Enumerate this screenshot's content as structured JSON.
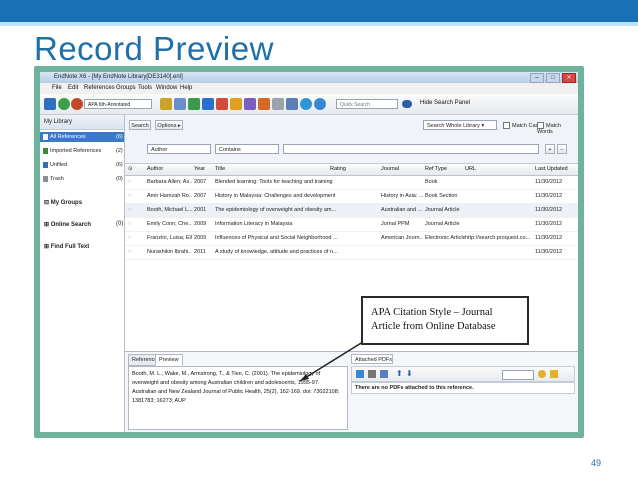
{
  "slide": {
    "title": "Record Preview",
    "page_number": "49",
    "colors": {
      "title": "#1f6fa8",
      "frame": "#6fb39c",
      "topbar": "#1a6fb5"
    }
  },
  "window": {
    "title": "EndNote X6 - [My EndNote Library[DE3140].enl]",
    "controls": [
      "–",
      "□",
      "✕"
    ]
  },
  "menu": [
    "File",
    "Edit",
    "References",
    "Groups",
    "Tools",
    "Window",
    "Help"
  ],
  "toolbar": {
    "style": "APA 6th-Annotated",
    "quick_search_placeholder": "Quick Search",
    "hide_search_panel": "Hide Search Panel"
  },
  "left_pane": {
    "header": "My Library",
    "items": [
      {
        "label": "All References",
        "count": "(6)",
        "icon": "library-icon"
      },
      {
        "label": "Imported References",
        "count": "(2)",
        "icon": "import-icon"
      },
      {
        "label": "Unfiled",
        "count": "(6)",
        "icon": "unfiled-icon"
      },
      {
        "label": "Trash",
        "count": "(0)",
        "icon": "trash-icon"
      }
    ],
    "groups": [
      "My Groups",
      "Online Search",
      "Find Full Text"
    ],
    "online_search_count": "(0)"
  },
  "search": {
    "search_button": "Search",
    "options_button": "Options",
    "scope": "Search Whole Library",
    "match_case": "Match Case",
    "match_words": "Match Words",
    "field": "Author",
    "operator": "Contains",
    "value": ""
  },
  "table": {
    "columns": [
      "Author",
      "Year",
      "Title",
      "Rating",
      "Journal",
      "Ref Type",
      "URL",
      "Last Updated"
    ],
    "rows": [
      [
        "Barbara Allen; As...",
        "2007",
        "Blended learning: Tools for teaching and training",
        "",
        "",
        "Book",
        "",
        "11/30/2012"
      ],
      [
        "Amir Hamzah Ro...",
        "2007",
        "History in Malaysia: Challenges and development",
        "",
        "History in Asia: ...",
        "Book Section",
        "",
        "11/30/2012"
      ],
      [
        "Booth, Michael L....",
        "2001",
        "The epidemiology of overweight and obesity am...",
        "",
        "Australian and ...",
        "Journal Article",
        "",
        "11/30/2012"
      ],
      [
        "Emily Conn; Che...",
        "2009",
        "Information Literacy in Malaysia",
        "",
        "Jurnal PPM",
        "Journal Article",
        "",
        "11/30/2012"
      ],
      [
        "Franzini, Luisa; Elli...",
        "2009",
        "Influences of Physical and Social Neighborhood ...",
        "",
        "American Journ...",
        "Electronic Article",
        "http://search.proquest.co...",
        "11/30/2012"
      ],
      [
        "Nurashikin Ibrahi...",
        "2011",
        "A study of knowledge, attitude and practices of n...",
        "",
        "",
        "",
        "",
        "11/30/2012"
      ]
    ]
  },
  "preview": {
    "tabs": [
      "Reference",
      "Preview"
    ],
    "text": "Booth, M. L., Wake, M., Armstrong, T., & Tien, C. (2001). The epidemiology of overweight and obesity among Australian children and adolescents, 1995-97. Australian and New Zealand Journal of Public Health, 25(2), 162-169. doi: 73022108; 1381783; 16273; AUP",
    "pdf_tab": "Attached PDFs",
    "pdf_message": "There are no PDFs attached to this reference."
  },
  "callout": {
    "line1": "APA Citation Style – Journal",
    "line2": "Article from Online Database"
  }
}
